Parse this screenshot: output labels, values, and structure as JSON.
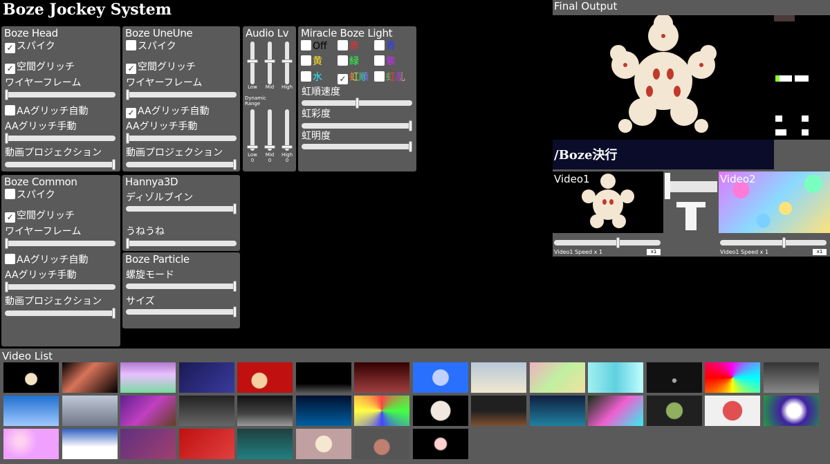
{
  "app_title": "Boze Jockey System",
  "boze_head": {
    "title": "Boze Head",
    "spike": "スパイク",
    "glitch": "空間グリッチ",
    "wire": "ワイヤーフレーム",
    "aa_auto": "AAグリッチ自動",
    "aa_manual": "AAグリッチ手動",
    "projection": "動画プロジェクション"
  },
  "boze_uneune": {
    "title": "Boze UneUne",
    "spike": "スパイク",
    "glitch": "空間グリッチ",
    "wire": "ワイヤーフレーム",
    "aa_auto": "AAグリッチ自動",
    "aa_manual": "AAグリッチ手動",
    "projection": "動画プロジェクション"
  },
  "boze_common": {
    "title": "Boze Common",
    "spike": "スパイク",
    "glitch": "空間グリッチ",
    "wire": "ワイヤーフレーム",
    "aa_auto": "AAグリッチ自動",
    "aa_manual": "AAグリッチ手動",
    "projection": "動画プロジェクション"
  },
  "audio": {
    "title": "Audio Lv",
    "low": "Low",
    "mid": "Mid",
    "high": "High",
    "dyn_title": "Dynamic Range",
    "low0": "Low",
    "mid0": "Mid",
    "high0": "High",
    "zero": "0"
  },
  "light": {
    "title": "Miracle Boze Light",
    "off": "Off",
    "red": "赤",
    "blue": "青",
    "yellow": "黄",
    "green": "緑",
    "purple": "紫",
    "cyan": "水",
    "rainbow1": "虹順",
    "rainbow2": "虹乱",
    "speed": "虹順速度",
    "sat": "虹彩度",
    "bright": "虹明度"
  },
  "hannya": {
    "title": "Hannya3D",
    "dissolve": "ディゾルブイン",
    "uneune": "うねうね"
  },
  "particle": {
    "title": "Boze Particle",
    "spiral": "螺旋モード",
    "size": "サイズ"
  },
  "output": {
    "title": "Final Output",
    "decide": "/Boze決行",
    "video1": "Video1",
    "video2": "Video2",
    "v1speed": "Video1 Speed x 1",
    "v2speed": "Video1 Speed x 1",
    "x1": "x1"
  },
  "video_list": {
    "title": "Video List"
  },
  "colors": {
    "panel": "#5a5a5a",
    "bg": "#000000",
    "decide_bg": "#0b0b2a"
  }
}
